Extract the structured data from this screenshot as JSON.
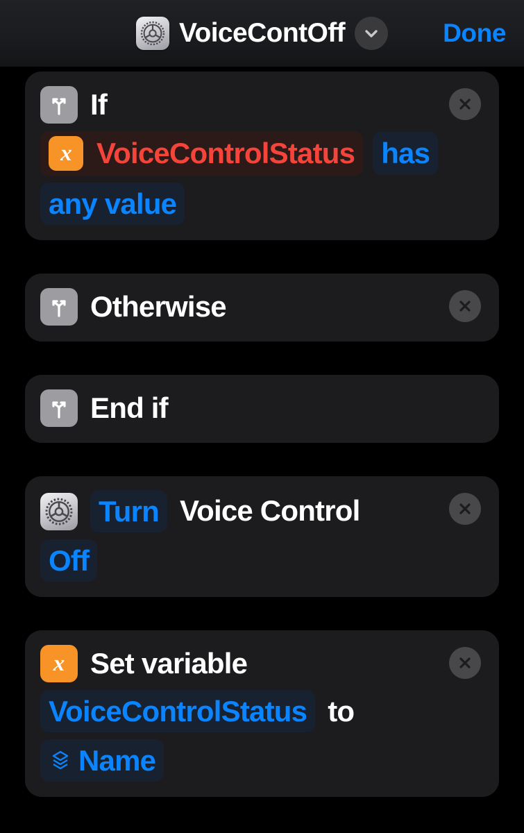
{
  "navbar": {
    "app_icon": "settings-gear-icon",
    "title": "VoiceContOff",
    "chevron": "chevron-down-icon",
    "done_label": "Done"
  },
  "colors": {
    "page_background": "#000000",
    "card_background": "#1c1c1e",
    "accent_blue": "#0a84ff",
    "token_blue_bg": "#17212f",
    "error_red": "#f5453a",
    "token_red_bg": "#2c1a19",
    "icon_gray": "#9c9ca1",
    "icon_orange": "#f79327",
    "close_button": "#48484a"
  },
  "actions": [
    {
      "id": "if",
      "icon": "branch-icon",
      "icon_color": "gray",
      "label": "If",
      "closable": true,
      "tokens": [
        {
          "text": "VoiceControlStatus",
          "style": "red",
          "icon": "variable-x-icon"
        },
        {
          "text": "has",
          "style": "blue"
        },
        {
          "text": "any value",
          "style": "blue"
        }
      ]
    },
    {
      "id": "otherwise",
      "icon": "branch-icon",
      "icon_color": "gray",
      "label": "Otherwise",
      "closable": true,
      "tokens": []
    },
    {
      "id": "end-if",
      "icon": "branch-icon",
      "icon_color": "gray",
      "label": "End if",
      "closable": false,
      "tokens": []
    },
    {
      "id": "turn-voice-control",
      "icon": "settings-gear-icon",
      "icon_color": "settings",
      "label": "Voice Control",
      "closable": true,
      "tokens": [
        {
          "text": "Turn",
          "style": "blue"
        },
        {
          "text": "Off",
          "style": "blue"
        }
      ]
    },
    {
      "id": "set-variable",
      "icon": "variable-x-icon",
      "icon_color": "orange",
      "label": "Set variable",
      "closable": true,
      "tokens": [
        {
          "text": "VoiceControlStatus",
          "style": "blue"
        },
        {
          "text": "to",
          "style": "plain"
        },
        {
          "text": "Name",
          "style": "blue",
          "icon": "magic-variable-icon"
        }
      ]
    }
  ],
  "card1": {
    "label": "If",
    "token_variable": "VoiceControlStatus",
    "token_has": "has",
    "token_any_value": "any value"
  },
  "card2": {
    "label": "Otherwise"
  },
  "card3": {
    "label": "End if"
  },
  "card4": {
    "token_turn": "Turn",
    "label": "Voice Control",
    "token_off": "Off"
  },
  "card5": {
    "label": "Set variable",
    "token_variable": "VoiceControlStatus",
    "word_to": "to",
    "token_name": "Name"
  }
}
